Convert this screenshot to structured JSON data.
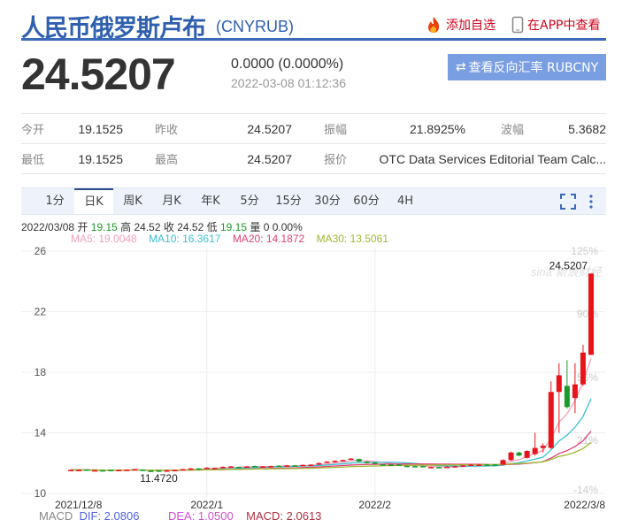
{
  "header": {
    "title": "人民币俄罗斯卢布",
    "code": "(CNYRUB)",
    "add_watch": "添加自选",
    "view_app": "在APP中查看"
  },
  "quote": {
    "price": "24.5207",
    "change": "0.0000 (0.0000%)",
    "time": "2022-03-08 01:12:36",
    "reverse_button": "查看反向汇率 RUBCNY"
  },
  "stats": [
    [
      {
        "label": "今开",
        "value": "19.1525"
      },
      {
        "label": "昨收",
        "value": "24.5207"
      },
      {
        "label": "振幅",
        "value": "21.8925%"
      },
      {
        "label": "波幅",
        "value": "5.3682"
      }
    ],
    [
      {
        "label": "最低",
        "value": "19.1525"
      },
      {
        "label": "最高",
        "value": "24.5207"
      },
      {
        "label": "报价",
        "value": "OTC Data Services Editorial Team Calc..."
      }
    ]
  ],
  "tabs": [
    "1分",
    "日K",
    "周K",
    "月K",
    "年K",
    "5分",
    "15分",
    "30分",
    "60分",
    "4H"
  ],
  "active_tab": "日K",
  "info": {
    "date": "2022/03/08",
    "open_l": "开",
    "open": "19.15",
    "high_l": "高",
    "high": "24.52",
    "close_l": "收",
    "close": "24.52",
    "low_l": "低",
    "low": "19.15",
    "vol_l": "量",
    "vol": "0 0.00%"
  },
  "ma": {
    "ma5": "MA5: 19.0048",
    "ma10": "MA10: 16.3617",
    "ma20": "MA20: 14.1872",
    "ma30": "MA30: 13.5061"
  },
  "macd": {
    "label": "MACD",
    "dif": "DIF: 2.0806",
    "dea": "DEA: 1.0500",
    "macd": "MACD: 2.0613"
  },
  "colors": {
    "up": "#e8141a",
    "down": "#1a9a2a",
    "ma5": "#f4a0b8",
    "ma10": "#3bbfd0",
    "ma20": "#e0407a",
    "ma30": "#a0b830"
  },
  "chart_data": {
    "type": "candlestick",
    "ylim": [
      10,
      26
    ],
    "y_ticks": [
      "26",
      "22",
      "18",
      "14",
      "10"
    ],
    "right_ticks": [
      "125%",
      "90%",
      "56%",
      "21%",
      "-14%"
    ],
    "x_labels": [
      "2021/12/8",
      "2022/1",
      "2022/2",
      "2022/3/8"
    ],
    "x_label_index": [
      0,
      17,
      38,
      65
    ],
    "max_label": "24.5207",
    "min_label": "11.4720",
    "min_index": 11,
    "closes": [
      11.55,
      11.55,
      11.54,
      11.53,
      11.52,
      11.52,
      11.55,
      11.56,
      11.6,
      11.5,
      11.48,
      11.5,
      11.52,
      11.55,
      11.6,
      11.65,
      11.62,
      11.7,
      11.68,
      11.75,
      11.78,
      11.72,
      11.78,
      11.8,
      11.78,
      11.8,
      11.82,
      11.85,
      11.83,
      11.88,
      11.9,
      12.0,
      12.1,
      12.15,
      12.2,
      12.3,
      12.1,
      12.0,
      11.95,
      11.9,
      11.88,
      11.85,
      11.8,
      11.78,
      11.75,
      11.74,
      11.73,
      11.76,
      11.8,
      11.85,
      11.9,
      11.9,
      11.88,
      11.9
    ],
    "ohlc_tail": [
      [
        11.9,
        12.25,
        11.88,
        12.2
      ],
      [
        12.2,
        12.75,
        12.15,
        12.7
      ],
      [
        12.7,
        12.75,
        12.45,
        12.5
      ],
      [
        12.35,
        12.85,
        12.3,
        12.8
      ],
      [
        12.6,
        14.0,
        12.5,
        13.0
      ],
      [
        13.0,
        13.3,
        12.7,
        13.15
      ],
      [
        13.0,
        17.4,
        12.95,
        16.7
      ],
      [
        16.7,
        18.6,
        14.0,
        17.8
      ],
      [
        17.1,
        18.8,
        15.6,
        15.7
      ],
      [
        16.3,
        18.6,
        15.3,
        17.2
      ],
      [
        17.2,
        19.8,
        17.1,
        19.3
      ],
      [
        19.15,
        24.52,
        19.15,
        24.52
      ]
    ]
  }
}
